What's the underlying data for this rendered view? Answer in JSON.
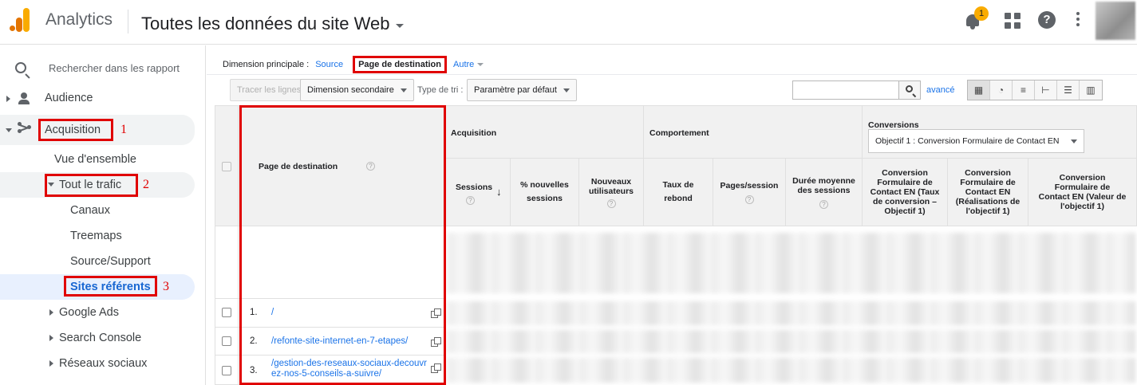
{
  "header": {
    "app_name": "Analytics",
    "property_name": "Toutes les données du site Web",
    "notification_count": "1",
    "help_glyph": "?"
  },
  "sidebar": {
    "search_placeholder": "Rechercher dans les rapport",
    "items": {
      "audience": "Audience",
      "acquisition": "Acquisition",
      "overview": "Vue d'ensemble",
      "all_traffic": "Tout le trafic",
      "channels": "Canaux",
      "treemaps": "Treemaps",
      "source_medium": "Source/Support",
      "referrals": "Sites référents",
      "google_ads": "Google Ads",
      "search_console": "Search Console",
      "social": "Réseaux sociaux"
    },
    "annotations": {
      "n1": "1",
      "n2": "2",
      "n3": "3"
    }
  },
  "main": {
    "dimension_label": "Dimension principale :",
    "dimension_source": "Source",
    "dimension_selected": "Page de destination",
    "dimension_other": "Autre",
    "toolbar": {
      "plot_rows": "Tracer les lignes",
      "secondary_dimension": "Dimension secondaire",
      "sort_type_label": "Type de tri :",
      "sort_default": "Paramètre par défaut",
      "advanced": "avancé"
    },
    "table": {
      "col_page": "Page de destination",
      "group_acquisition": "Acquisition",
      "group_behavior": "Comportement",
      "group_conversions": "Conversions",
      "goal_select": "Objectif 1 : Conversion Formulaire de Contact EN",
      "col_sessions": "Sessions",
      "col_new_sessions": "% nouvelles sessions",
      "col_new_users": "Nouveaux utilisateurs",
      "col_bounce": "Taux de rebond",
      "col_pages_session": "Pages/session",
      "col_avg_duration": "Durée moyenne des sessions",
      "col_conv_rate": "Conversion Formulaire de Contact EN (Taux de conversion – Objectif 1)",
      "col_conv_completions": "Conversion Formulaire de Contact EN (Réalisations de l'objectif 1)",
      "col_conv_value": "Conversion Formulaire de Contact EN (Valeur de l'objectif 1)",
      "rows": [
        {
          "idx": "1.",
          "page": "/"
        },
        {
          "idx": "2.",
          "page": "/refonte-site-internet-en-7-etapes/"
        },
        {
          "idx": "3.",
          "page": "/gestion-des-reseaux-sociaux-decouvrez-nos-5-conseils-a-suivre/"
        }
      ]
    }
  },
  "colors": {
    "accent": "#1a73e8",
    "annotation_red": "#e00000",
    "logo_orange": "#e37400",
    "logo_yellow": "#f9ab00",
    "selected_bg": "#e8f0fe"
  }
}
